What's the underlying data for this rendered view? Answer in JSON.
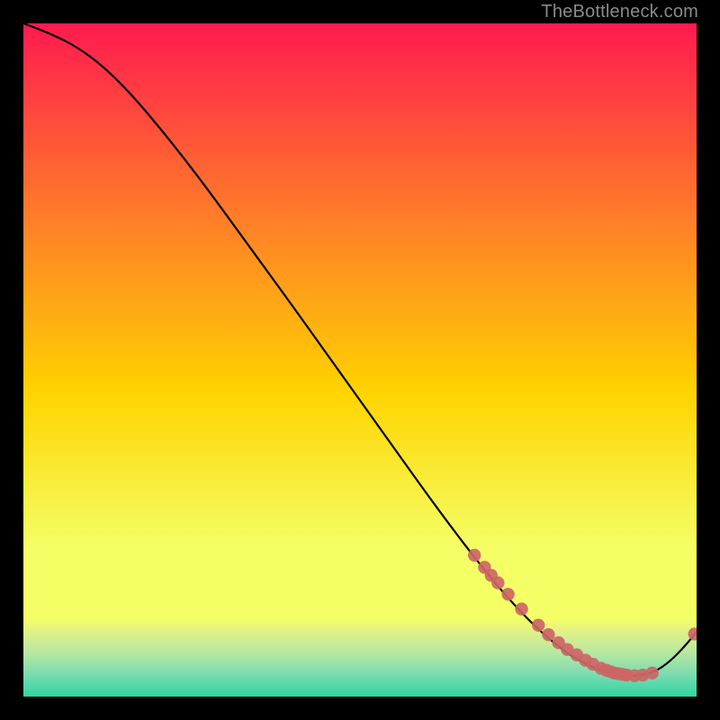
{
  "watermark": "TheBottleneck.com",
  "colors": {
    "bg_black": "#000000",
    "marker_fill": "#cc6666",
    "marker_fill_alt": "#d17a7a",
    "line": "#000000",
    "grad_top": "#ff1a4f",
    "grad_mid1": "#ff7a2a",
    "grad_mid2": "#ffd400",
    "grad_mid3": "#f4ff66",
    "grad_band1": "#dff08a",
    "grad_band2": "#b6e8a0",
    "grad_band3": "#7fdcb0",
    "grad_bottom": "#2fd5a3"
  },
  "chart_data": {
    "type": "line",
    "title": "",
    "xlabel": "",
    "ylabel": "",
    "xlim": [
      0,
      100
    ],
    "ylim": [
      0,
      100
    ],
    "grid": false,
    "note": "Axes have no tick labels. x/y arrays are pixel-fraction positions (0=left/bottom, 100=right/top) estimated from the image.",
    "series": [
      {
        "name": "curve",
        "kind": "line",
        "x": [
          0,
          4,
          8,
          12,
          16,
          20,
          24,
          28,
          32,
          36,
          40,
          44,
          48,
          52,
          56,
          60,
          64,
          68,
          72,
          76,
          80,
          82,
          84,
          86,
          88,
          90,
          92,
          94,
          96,
          98,
          100
        ],
        "y": [
          100,
          98.5,
          96.5,
          93.5,
          89.5,
          84.8,
          79.8,
          74.5,
          69,
          63.5,
          58,
          52.4,
          46.8,
          41.2,
          35.6,
          30,
          24.6,
          19.4,
          14.6,
          10.4,
          7,
          5.7,
          4.6,
          3.8,
          3.2,
          3,
          3.2,
          3.8,
          5.2,
          7.2,
          9.6
        ]
      },
      {
        "name": "points",
        "kind": "scatter",
        "x": [
          67,
          68.5,
          69.5,
          70.5,
          72,
          74,
          76.5,
          78,
          79.5,
          80.8,
          82.2,
          83.5,
          84.6,
          85.8,
          86.6,
          87.2,
          87.8,
          88.4,
          89,
          89.6,
          90.8,
          92,
          93.4,
          99.7
        ],
        "y": [
          21.0,
          19.2,
          18.0,
          16.9,
          15.2,
          13.0,
          10.6,
          9.2,
          8.0,
          7.0,
          6.2,
          5.4,
          4.8,
          4.2,
          3.9,
          3.7,
          3.5,
          3.4,
          3.3,
          3.2,
          3.1,
          3.2,
          3.5,
          9.3
        ]
      }
    ]
  }
}
